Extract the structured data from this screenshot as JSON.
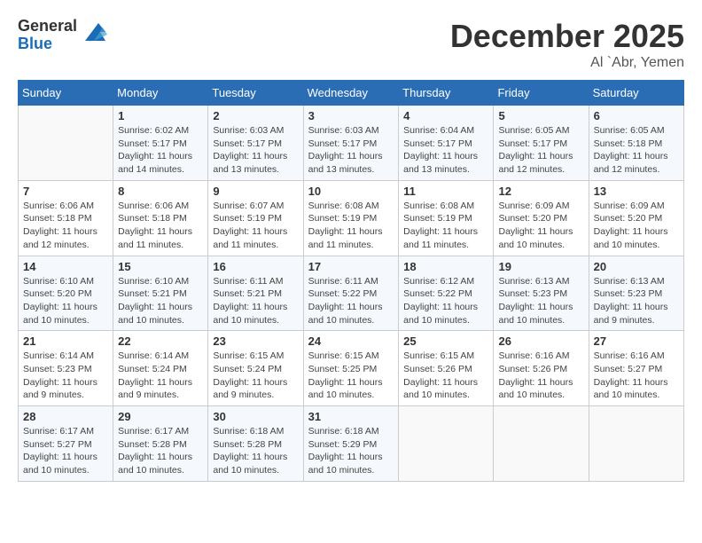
{
  "logo": {
    "general": "General",
    "blue": "Blue"
  },
  "title": "December 2025",
  "location": "Al `Abr, Yemen",
  "weekdays": [
    "Sunday",
    "Monday",
    "Tuesday",
    "Wednesday",
    "Thursday",
    "Friday",
    "Saturday"
  ],
  "weeks": [
    [
      {
        "day": "",
        "info": ""
      },
      {
        "day": "1",
        "info": "Sunrise: 6:02 AM\nSunset: 5:17 PM\nDaylight: 11 hours\nand 14 minutes."
      },
      {
        "day": "2",
        "info": "Sunrise: 6:03 AM\nSunset: 5:17 PM\nDaylight: 11 hours\nand 13 minutes."
      },
      {
        "day": "3",
        "info": "Sunrise: 6:03 AM\nSunset: 5:17 PM\nDaylight: 11 hours\nand 13 minutes."
      },
      {
        "day": "4",
        "info": "Sunrise: 6:04 AM\nSunset: 5:17 PM\nDaylight: 11 hours\nand 13 minutes."
      },
      {
        "day": "5",
        "info": "Sunrise: 6:05 AM\nSunset: 5:17 PM\nDaylight: 11 hours\nand 12 minutes."
      },
      {
        "day": "6",
        "info": "Sunrise: 6:05 AM\nSunset: 5:18 PM\nDaylight: 11 hours\nand 12 minutes."
      }
    ],
    [
      {
        "day": "7",
        "info": "Sunrise: 6:06 AM\nSunset: 5:18 PM\nDaylight: 11 hours\nand 12 minutes."
      },
      {
        "day": "8",
        "info": "Sunrise: 6:06 AM\nSunset: 5:18 PM\nDaylight: 11 hours\nand 11 minutes."
      },
      {
        "day": "9",
        "info": "Sunrise: 6:07 AM\nSunset: 5:19 PM\nDaylight: 11 hours\nand 11 minutes."
      },
      {
        "day": "10",
        "info": "Sunrise: 6:08 AM\nSunset: 5:19 PM\nDaylight: 11 hours\nand 11 minutes."
      },
      {
        "day": "11",
        "info": "Sunrise: 6:08 AM\nSunset: 5:19 PM\nDaylight: 11 hours\nand 11 minutes."
      },
      {
        "day": "12",
        "info": "Sunrise: 6:09 AM\nSunset: 5:20 PM\nDaylight: 11 hours\nand 10 minutes."
      },
      {
        "day": "13",
        "info": "Sunrise: 6:09 AM\nSunset: 5:20 PM\nDaylight: 11 hours\nand 10 minutes."
      }
    ],
    [
      {
        "day": "14",
        "info": "Sunrise: 6:10 AM\nSunset: 5:20 PM\nDaylight: 11 hours\nand 10 minutes."
      },
      {
        "day": "15",
        "info": "Sunrise: 6:10 AM\nSunset: 5:21 PM\nDaylight: 11 hours\nand 10 minutes."
      },
      {
        "day": "16",
        "info": "Sunrise: 6:11 AM\nSunset: 5:21 PM\nDaylight: 11 hours\nand 10 minutes."
      },
      {
        "day": "17",
        "info": "Sunrise: 6:11 AM\nSunset: 5:22 PM\nDaylight: 11 hours\nand 10 minutes."
      },
      {
        "day": "18",
        "info": "Sunrise: 6:12 AM\nSunset: 5:22 PM\nDaylight: 11 hours\nand 10 minutes."
      },
      {
        "day": "19",
        "info": "Sunrise: 6:13 AM\nSunset: 5:23 PM\nDaylight: 11 hours\nand 10 minutes."
      },
      {
        "day": "20",
        "info": "Sunrise: 6:13 AM\nSunset: 5:23 PM\nDaylight: 11 hours\nand 9 minutes."
      }
    ],
    [
      {
        "day": "21",
        "info": "Sunrise: 6:14 AM\nSunset: 5:23 PM\nDaylight: 11 hours\nand 9 minutes."
      },
      {
        "day": "22",
        "info": "Sunrise: 6:14 AM\nSunset: 5:24 PM\nDaylight: 11 hours\nand 9 minutes."
      },
      {
        "day": "23",
        "info": "Sunrise: 6:15 AM\nSunset: 5:24 PM\nDaylight: 11 hours\nand 9 minutes."
      },
      {
        "day": "24",
        "info": "Sunrise: 6:15 AM\nSunset: 5:25 PM\nDaylight: 11 hours\nand 10 minutes."
      },
      {
        "day": "25",
        "info": "Sunrise: 6:15 AM\nSunset: 5:26 PM\nDaylight: 11 hours\nand 10 minutes."
      },
      {
        "day": "26",
        "info": "Sunrise: 6:16 AM\nSunset: 5:26 PM\nDaylight: 11 hours\nand 10 minutes."
      },
      {
        "day": "27",
        "info": "Sunrise: 6:16 AM\nSunset: 5:27 PM\nDaylight: 11 hours\nand 10 minutes."
      }
    ],
    [
      {
        "day": "28",
        "info": "Sunrise: 6:17 AM\nSunset: 5:27 PM\nDaylight: 11 hours\nand 10 minutes."
      },
      {
        "day": "29",
        "info": "Sunrise: 6:17 AM\nSunset: 5:28 PM\nDaylight: 11 hours\nand 10 minutes."
      },
      {
        "day": "30",
        "info": "Sunrise: 6:18 AM\nSunset: 5:28 PM\nDaylight: 11 hours\nand 10 minutes."
      },
      {
        "day": "31",
        "info": "Sunrise: 6:18 AM\nSunset: 5:29 PM\nDaylight: 11 hours\nand 10 minutes."
      },
      {
        "day": "",
        "info": ""
      },
      {
        "day": "",
        "info": ""
      },
      {
        "day": "",
        "info": ""
      }
    ]
  ]
}
